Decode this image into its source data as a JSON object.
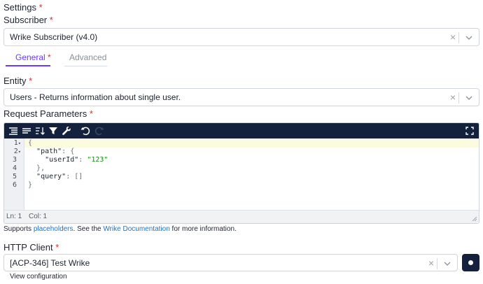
{
  "settings": {
    "label": "Settings",
    "required": "*"
  },
  "subscriber": {
    "label": "Subscriber",
    "required": "*",
    "value": "Wrike Subscriber (v4.0)"
  },
  "tabs": [
    {
      "label": "General",
      "required": "*"
    },
    {
      "label": "Advanced"
    }
  ],
  "entity": {
    "label": "Entity",
    "required": "*",
    "value": "Users - Returns information about single user."
  },
  "request_params": {
    "label": "Request Parameters",
    "required": "*",
    "line_numbers": [
      "1",
      "2",
      "3",
      "4",
      "5",
      "6"
    ],
    "status_ln": "Ln: 1",
    "status_col": "Col: 1"
  },
  "help": {
    "prefix": "Supports ",
    "placeholders_link": "placeholders",
    "middle": ". See the ",
    "doc_link": "Wrike Documentation",
    "suffix": " for more information."
  },
  "http_client": {
    "label": "HTTP Client",
    "required": "*",
    "value": "[ACP-346] Test Wrike",
    "view_config": "View configuration"
  },
  "colors": {
    "accent": "#6a3df0",
    "toolbar": "#14213d",
    "link": "#1a73c7",
    "required": "#d92c2c"
  }
}
